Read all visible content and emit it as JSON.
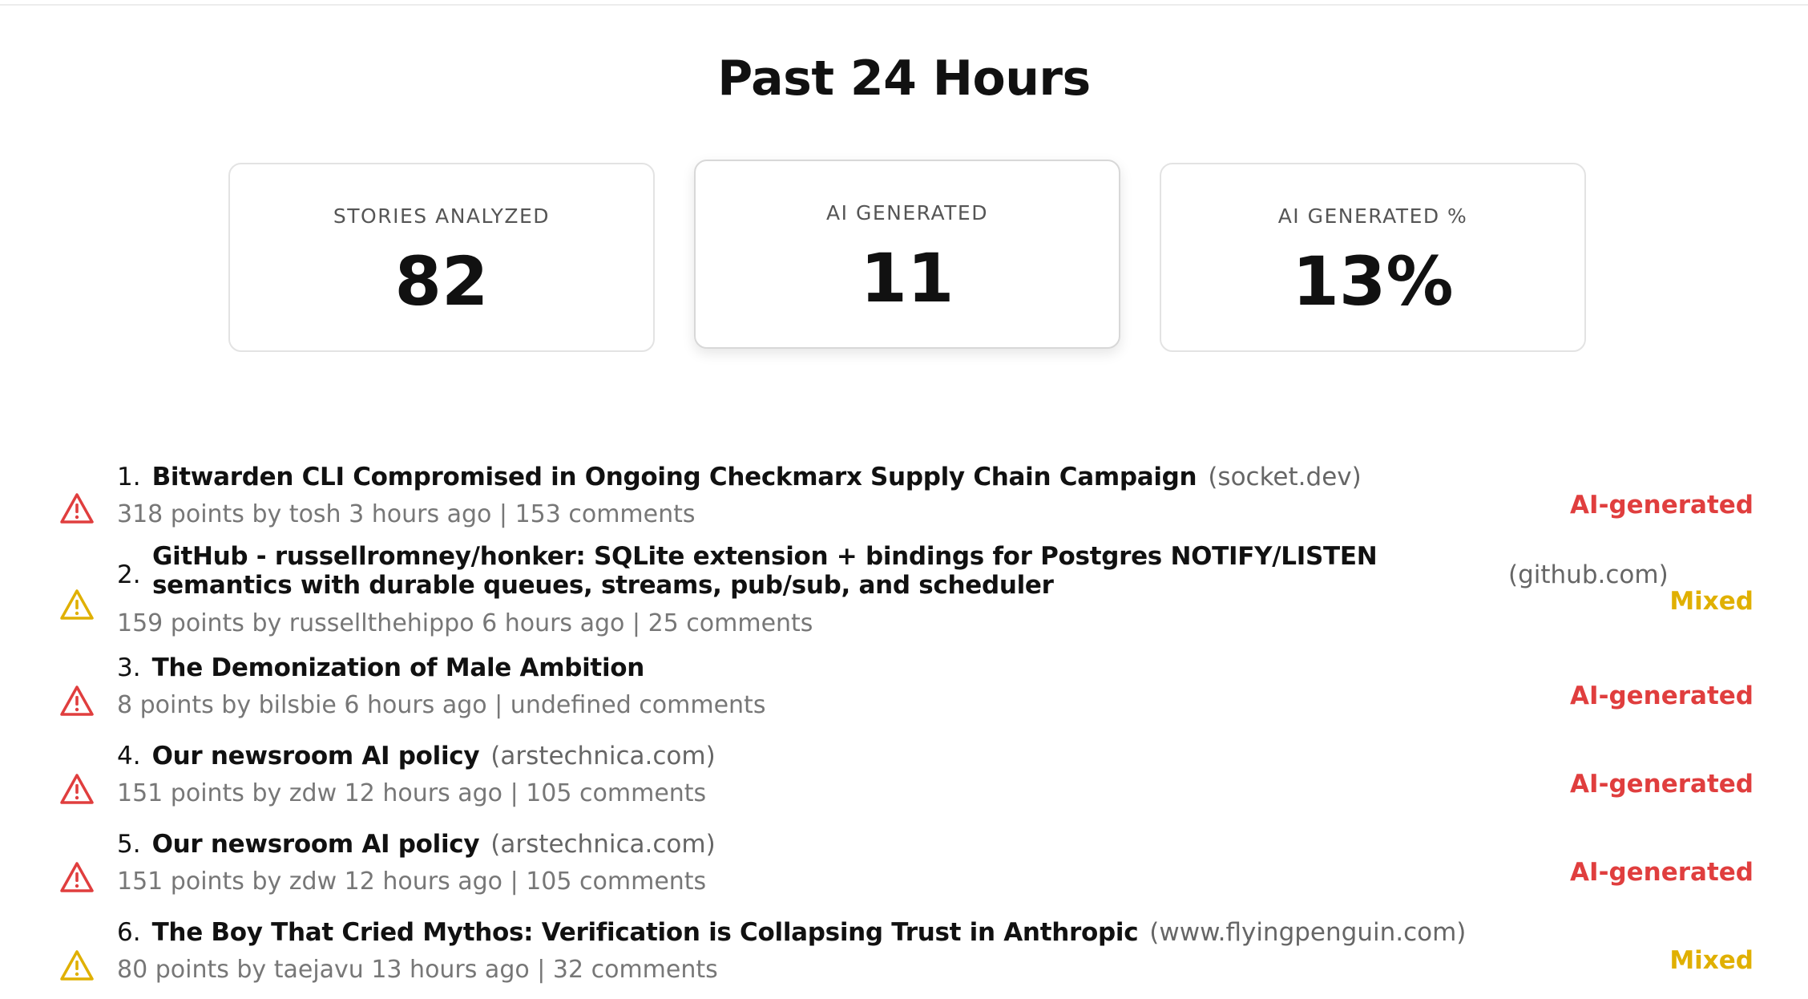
{
  "page": {
    "title": "Past 24 Hours"
  },
  "stats": [
    {
      "label": "STORIES ANALYZED",
      "value": "82"
    },
    {
      "label": "AI GENERATED",
      "value": "11"
    },
    {
      "label": "AI GENERATED %",
      "value": "13%"
    }
  ],
  "colors": {
    "ai_generated": "#e03e3e",
    "mixed": "#e0b000"
  },
  "stories": [
    {
      "rank": "1.",
      "title": "Bitwarden CLI Compromised in Ongoing Checkmarx Supply Chain Campaign",
      "domain": "(socket.dev)",
      "meta": "318 points by tosh 3 hours ago | 153 comments",
      "badge": "AI-generated",
      "icon": "warning-triangle-red-icon"
    },
    {
      "rank": "2.",
      "title": "GitHub - russellromney/honker: SQLite extension + bindings for Postgres NOTIFY/LISTEN semantics with durable queues, streams, pub/sub, and scheduler",
      "domain": "(github.com)",
      "meta": "159 points by russellthehippo 6 hours ago | 25 comments",
      "badge": "Mixed",
      "icon": "warning-triangle-yellow-icon"
    },
    {
      "rank": "3.",
      "title": "The Demonization of Male Ambition",
      "domain": "",
      "meta": "8 points by bilsbie 6 hours ago | undefined comments",
      "badge": "AI-generated",
      "icon": "warning-triangle-red-icon"
    },
    {
      "rank": "4.",
      "title": "Our newsroom AI policy",
      "domain": "(arstechnica.com)",
      "meta": "151 points by zdw 12 hours ago | 105 comments",
      "badge": "AI-generated",
      "icon": "warning-triangle-red-icon"
    },
    {
      "rank": "5.",
      "title": "Our newsroom AI policy",
      "domain": "(arstechnica.com)",
      "meta": "151 points by zdw 12 hours ago | 105 comments",
      "badge": "AI-generated",
      "icon": "warning-triangle-red-icon"
    },
    {
      "rank": "6.",
      "title": "The Boy That Cried Mythos: Verification is Collapsing Trust in Anthropic",
      "domain": "(www.flyingpenguin.com)",
      "meta": "80 points by taejavu 13 hours ago | 32 comments",
      "badge": "Mixed",
      "icon": "warning-triangle-yellow-icon"
    }
  ]
}
